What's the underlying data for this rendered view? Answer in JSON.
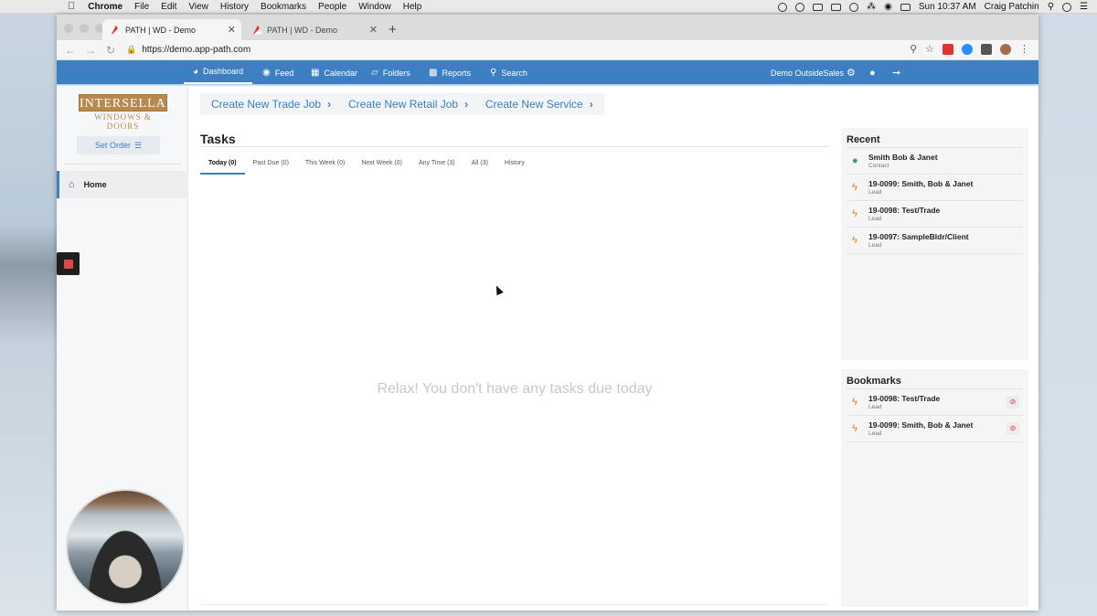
{
  "menubar": {
    "app": "Chrome",
    "items": [
      "File",
      "Edit",
      "View",
      "History",
      "Bookmarks",
      "People",
      "Window",
      "Help"
    ],
    "clock": "Sun 10:37 AM",
    "user": "Craig Patchin"
  },
  "browser": {
    "tabs": [
      {
        "title": "PATH | WD - Demo",
        "active": true
      },
      {
        "title": "PATH | WD - Demo",
        "active": false
      }
    ],
    "url": "https://demo.app-path.com"
  },
  "nav": {
    "items": [
      {
        "label": "Dashboard",
        "icon": "dashboard-icon"
      },
      {
        "label": "Feed",
        "icon": "globe-icon"
      },
      {
        "label": "Calendar",
        "icon": "calendar-icon"
      },
      {
        "label": "Folders",
        "icon": "folder-icon"
      },
      {
        "label": "Reports",
        "icon": "bar-chart-icon"
      },
      {
        "label": "Search",
        "icon": "search-icon"
      }
    ],
    "account": "Demo OutsideSales"
  },
  "sidebar": {
    "logo_top": "INTERSELLAR",
    "logo_bottom": "WINDOWS & DOORS",
    "set_order": "Set Order",
    "home": "Home"
  },
  "actions": {
    "trade": "Create New Trade Job",
    "retail": "Create New Retail Job",
    "service": "Create New Service"
  },
  "tasks": {
    "title": "Tasks",
    "tabs": [
      "Today (0)",
      "Past Due (0)",
      "This Week (0)",
      "Next Week (0)",
      "Any Time (3)",
      "All (3)",
      "History"
    ],
    "empty": "Relax! You don't have any tasks due today"
  },
  "recent": {
    "title": "Recent",
    "items": [
      {
        "name": "Smith Bob & Janet",
        "type": "Contact"
      },
      {
        "name": "19-0099: Smith, Bob & Janet",
        "type": "Lead"
      },
      {
        "name": "19-0098: Test/Trade",
        "type": "Lead"
      },
      {
        "name": "19-0097: SampleBldr/Client",
        "type": "Lead"
      }
    ]
  },
  "bookmarks": {
    "title": "Bookmarks",
    "items": [
      {
        "name": "19-0098: Test/Trade",
        "type": "Lead"
      },
      {
        "name": "19-0099: Smith, Bob & Janet",
        "type": "Lead"
      }
    ]
  },
  "colors": {
    "accent": "#3c7fc3",
    "lead_icon": "#e07a1f",
    "contact_icon": "#3a9a7a"
  }
}
